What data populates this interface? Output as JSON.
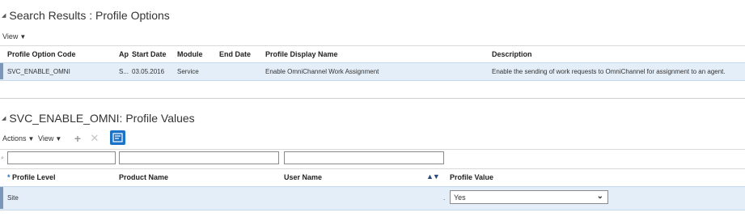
{
  "search_results": {
    "title": "Search Results : Profile Options",
    "view_label": "View",
    "columns": [
      "Profile Option Code",
      "Ap",
      "Start Date",
      "Module",
      "End Date",
      "Profile Display Name",
      "Description"
    ],
    "row": {
      "code": "SVC_ENABLE_OMNI",
      "ap": "S...",
      "start_date": "03.05.2016",
      "module": "Service",
      "end_date": "",
      "display_name": "Enable OmniChannel Work Assignment",
      "description": "Enable the sending of work requests to OmniChannel for assignment to an agent."
    }
  },
  "profile_values": {
    "title": "SVC_ENABLE_OMNI: Profile Values",
    "actions_label": "Actions",
    "view_label": "View",
    "columns": {
      "required_mark": "*",
      "level": "Profile Level",
      "product": "Product Name",
      "user": "User Name",
      "value": "Profile Value"
    },
    "row": {
      "level": "Site",
      "product": "",
      "user": ".",
      "value": "Yes"
    }
  },
  "colors": {
    "selected_row": "#e4eef8",
    "accent_button": "#1a73c7"
  }
}
